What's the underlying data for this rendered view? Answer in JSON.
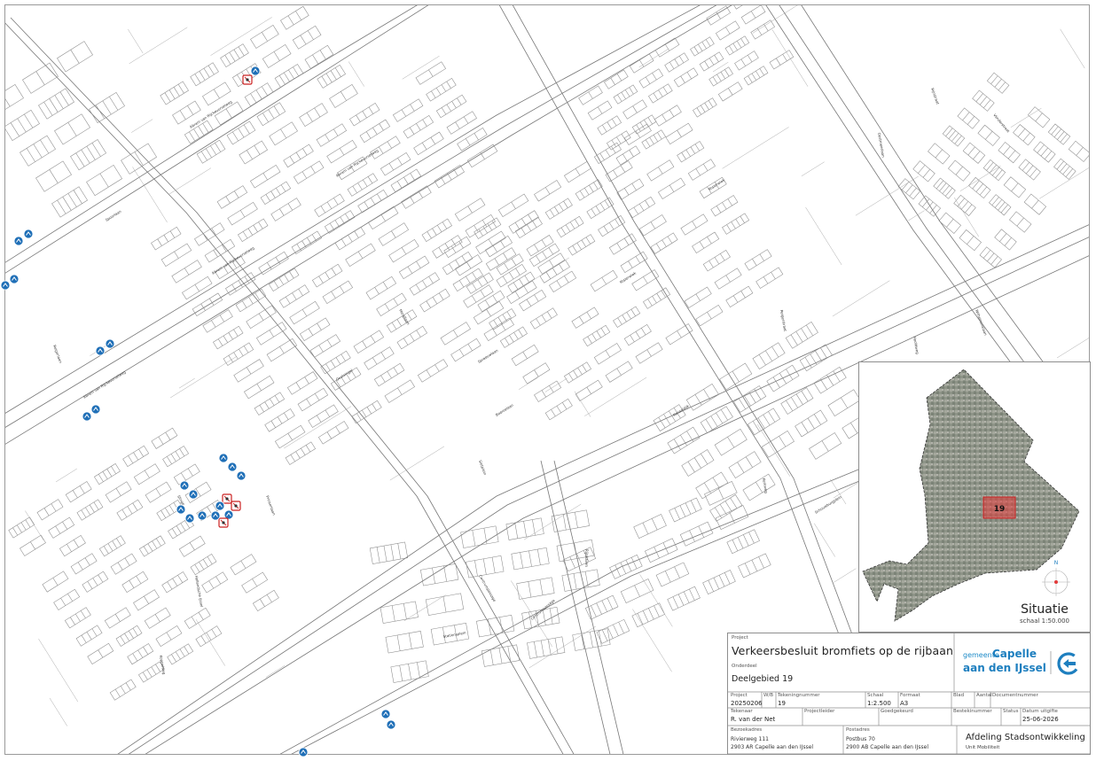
{
  "map": {
    "street_labels": [
      "Abram van Rijckevorselweg",
      "Abram van Rijckevorselweg",
      "Abram van Rijckevorselweg",
      "Abram van Rijckevorselweg",
      "Reigerlaan",
      "Merellaan",
      "Slotplein",
      "Koperwiek",
      "Spreeuwlaan",
      "Boeroelaan",
      "Rijnhaven",
      "Slinge",
      "Prinsenlaan",
      "Centrumpassage",
      "Centrumpassage",
      "Stationsplein",
      "Oostmeerlaan",
      "Koperwiek",
      "Hoofdweg",
      "Oostsingel",
      "Kanaaldijk",
      "Hollandsche IJssel",
      "Koppelweg",
      "Kerkweg",
      "Reigerstraat",
      "Vlinderstraat",
      "Rijnstraat",
      "Wilhelminalaan",
      "Spoorlaan",
      "Schouwburgplein"
    ]
  },
  "situatie": {
    "title": "Situatie",
    "scale": "schaal 1:50.000",
    "area_number": "19",
    "north_label": "N"
  },
  "titleblock": {
    "project_label": "Project",
    "project_title": "Verkeersbesluit bromfiets op de rijbaan",
    "subject_label": "Onderdeel",
    "subject_value": "Deelgebied 19",
    "logo": {
      "prefix": "gemeente",
      "name_line1": "Capelle",
      "name_line2": "aan den IJssel"
    },
    "fields_row1": [
      {
        "label": "Project",
        "value": "20250206"
      },
      {
        "label": "W/B",
        "value": ""
      },
      {
        "label": "Tekeningnummer",
        "value": "19"
      },
      {
        "label": "Schaal",
        "value": "1:2.500"
      },
      {
        "label": "Formaat",
        "value": "A3"
      },
      {
        "label": "Blad",
        "value": ""
      },
      {
        "label": "Aantal",
        "value": ""
      },
      {
        "label": "Documentnummer",
        "value": ""
      }
    ],
    "fields_row2": [
      {
        "label": "Tekenaar",
        "value": "R. van der Net"
      },
      {
        "label": "Projectleider",
        "value": ""
      },
      {
        "label": "Goedgekeurd",
        "value": ""
      },
      {
        "label": "Bestekinummer",
        "value": ""
      },
      {
        "label": "Status",
        "value": ""
      },
      {
        "label": "Datum uitgifte",
        "value": "25-06-2026"
      }
    ],
    "bezoekadres_label": "Bezoekadres",
    "bezoekadres_line1": "Rivierweg 111",
    "bezoekadres_line2": "2903 AR Capelle aan den IJssel",
    "postadres_label": "Postadres",
    "postadres_line1": "Postbus 70",
    "postadres_line2": "2900 AB Capelle aan den IJssel",
    "department": "Afdeling Stadsontwikkeling",
    "unit": "Unit Mobiliteit"
  },
  "colors": {
    "line": "#8a8a8a",
    "sign_blue": "#1f6fb7",
    "sign_red": "#cc2222",
    "area_highlight": "#e23b3b"
  },
  "icons": [
    "traffic-sign-icon",
    "north-arrow-icon"
  ]
}
